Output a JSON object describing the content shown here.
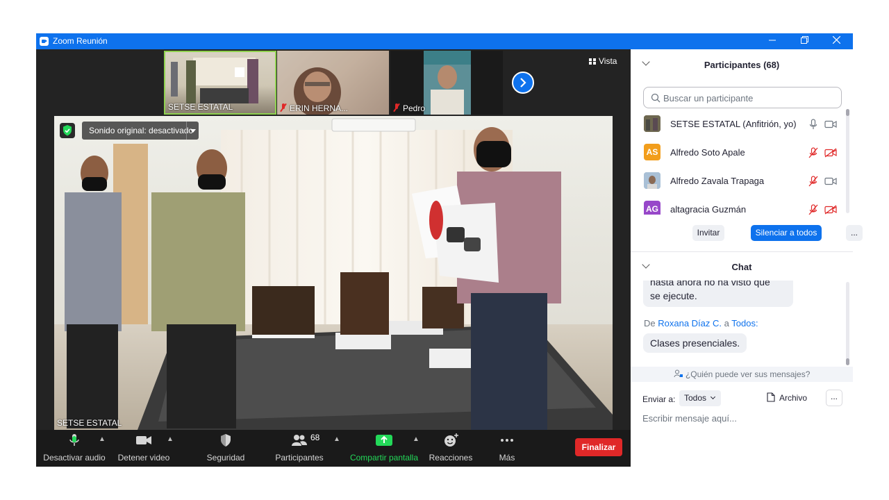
{
  "window": {
    "title": "Zoom Reunión"
  },
  "top_bar": {
    "view_label": "Vista"
  },
  "thumbnails": [
    {
      "name": "SETSE ESTATAL",
      "muted": false,
      "active": true
    },
    {
      "name": "ERIN HERNA...",
      "muted": true,
      "active": false
    },
    {
      "name": "Pedro",
      "muted": true,
      "active": false
    }
  ],
  "main_video": {
    "sound_label": "Sonido original: desactivado",
    "speaker_name": "SETSE ESTATAL"
  },
  "toolbar": {
    "mute_label": "Desactivar audio",
    "video_label": "Detener video",
    "security_label": "Seguridad",
    "participants_label": "Participantes",
    "participants_count": "68",
    "share_label": "Compartir pantalla",
    "reactions_label": "Reacciones",
    "more_label": "Más",
    "end_label": "Finalizar"
  },
  "participants_panel": {
    "title": "Participantes (68)",
    "search_placeholder": "Buscar un participante",
    "list": [
      {
        "name": "SETSE ESTATAL (Anfitrión, yo)",
        "initials": "",
        "avatar_color": "#5c5740",
        "muted": false,
        "video_off": false
      },
      {
        "name": "Alfredo Soto Apale",
        "initials": "AS",
        "avatar_color": "#f29e1c",
        "muted": true,
        "video_off": true
      },
      {
        "name": "Alfredo Zavala Trapaga",
        "initials": "",
        "avatar_color": "#9ab0c7",
        "muted": true,
        "video_off": false
      },
      {
        "name": "altagracia Guzmán",
        "initials": "AG",
        "avatar_color": "#9747c9",
        "muted": true,
        "video_off": true
      }
    ],
    "invite_label": "Invitar",
    "mute_all_label": "Silenciar a todos",
    "more_label": "..."
  },
  "chat_panel": {
    "title": "Chat",
    "partial_line_1": "hasta ahora no ha visto que",
    "partial_line_2": "se ejecute.",
    "from_prefix": "De",
    "from_name": "Roxana Díaz C.",
    "to_word": "a",
    "to_name": "Todos:",
    "last_message": "Clases presenciales.",
    "who_can_see": "¿Quién puede ver sus mensajes?",
    "send_to_label": "Enviar a:",
    "send_to_value": "Todos",
    "file_label": "Archivo",
    "more_label": "...",
    "input_placeholder": "Escribir mensaje aquí..."
  },
  "colors": {
    "accent": "#0e72ed",
    "end_button": "#e02828",
    "share_green": "#23d959",
    "muted_red": "#e02828"
  }
}
